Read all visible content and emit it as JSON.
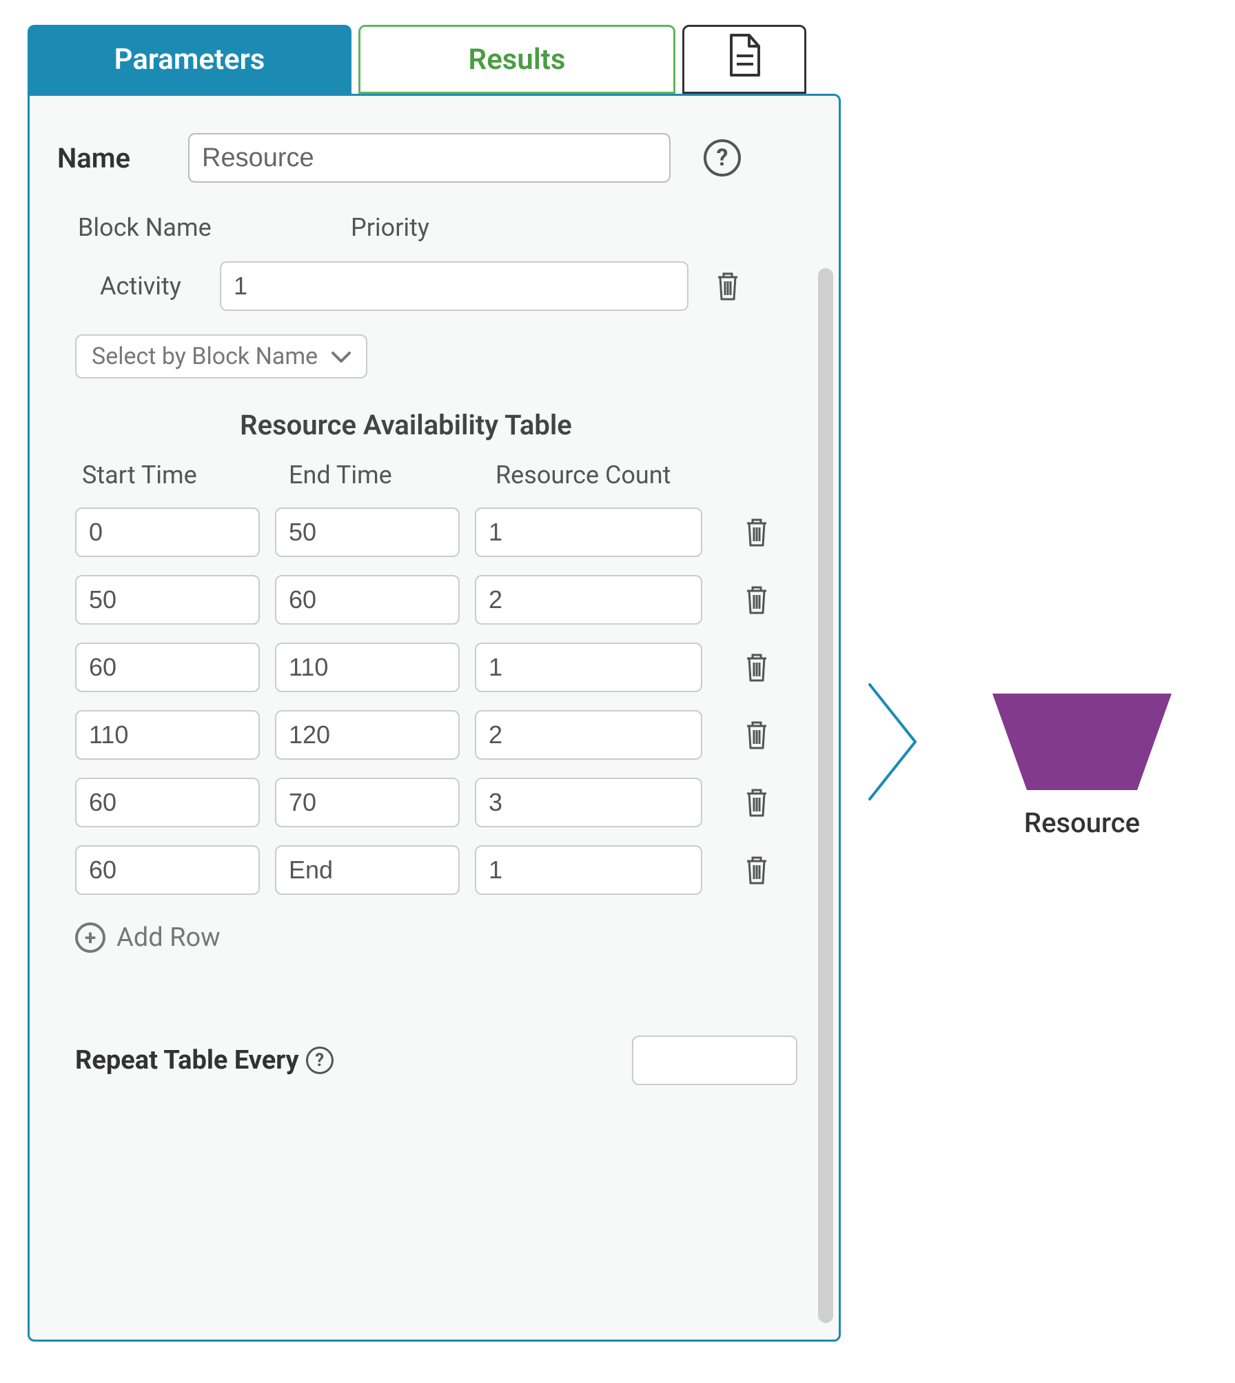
{
  "tabs": {
    "parameters": "Parameters",
    "results": "Results"
  },
  "name": {
    "label": "Name",
    "value": "Resource"
  },
  "headers": {
    "block_name": "Block Name",
    "priority": "Priority"
  },
  "activity": {
    "label": "Activity",
    "priority_value": "1"
  },
  "select_block": "Select by Block Name",
  "table_title": "Resource Availability Table",
  "table_headers": {
    "start": "Start Time",
    "end": "End Time",
    "count": "Resource Count"
  },
  "rows": [
    {
      "start": "0",
      "end": "50",
      "count": "1"
    },
    {
      "start": "50",
      "end": "60",
      "count": "2"
    },
    {
      "start": "60",
      "end": "110",
      "count": "1"
    },
    {
      "start": "110",
      "end": "120",
      "count": "2"
    },
    {
      "start": "60",
      "end": "70",
      "count": "3"
    },
    {
      "start": "60",
      "end": "End",
      "count": "1"
    }
  ],
  "add_row": "Add Row",
  "repeat": {
    "label": "Repeat Table Every",
    "value": ""
  },
  "block": {
    "label": "Resource",
    "color": "#813a8c"
  }
}
